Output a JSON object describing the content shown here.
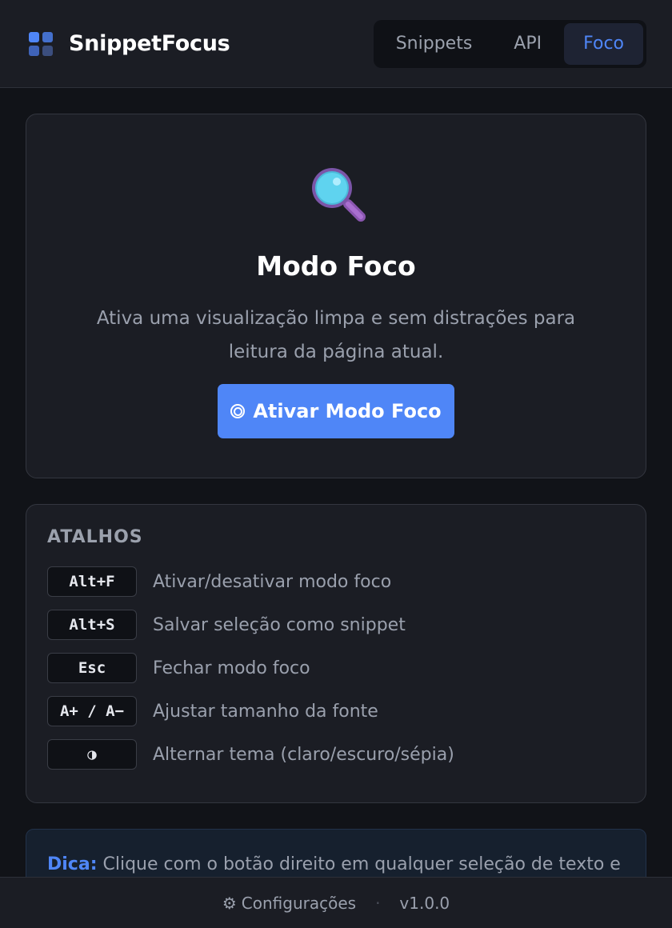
{
  "header": {
    "brand": "SnippetFocus",
    "tabs": [
      {
        "label": "Snippets"
      },
      {
        "label": "API"
      },
      {
        "label": "Foco"
      }
    ],
    "active_tab": "Foco"
  },
  "focus": {
    "icon": "magnifying-glass",
    "title": "Modo Foco",
    "description": "Ativa uma visualização limpa e sem distrações para leitura da página atual.",
    "button_label": "Ativar Modo Foco"
  },
  "shortcuts": {
    "heading": "ATALHOS",
    "items": [
      {
        "key": "Alt+F",
        "desc": "Ativar/desativar modo foco"
      },
      {
        "key": "Alt+S",
        "desc": "Salvar seleção como snippet"
      },
      {
        "key": "Esc",
        "desc": "Fechar modo foco"
      },
      {
        "key": "A+ / A−",
        "desc": "Ajustar tamanho da fonte"
      },
      {
        "key": "◑",
        "desc": "Alternar tema (claro/escuro/sépia)"
      }
    ]
  },
  "tip": {
    "label": "Dica:",
    "text": "Clique com o botão direito em qualquer seleção de texto e"
  },
  "footer": {
    "settings_label": "Configurações",
    "separator": "·",
    "version": "v1.0.0"
  },
  "colors": {
    "accent": "#4f86f7",
    "background": "#111318",
    "surface": "#1b1d24"
  }
}
